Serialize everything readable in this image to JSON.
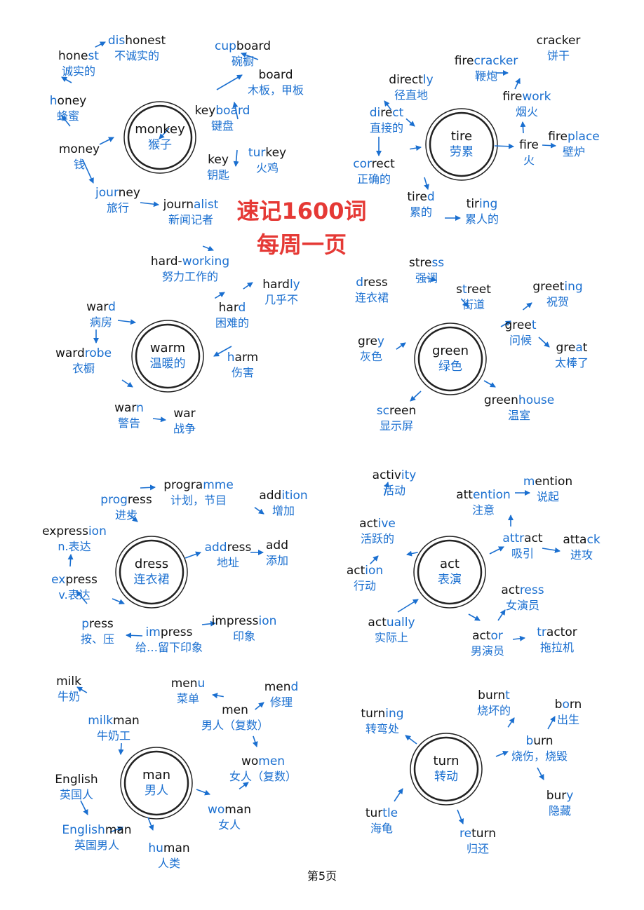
{
  "title_lines": [
    "速记1600词",
    "每周一页"
  ],
  "footer": "第5页",
  "colors": {
    "accent": "#1a6fd0",
    "title": "#e53935",
    "text": "#111111"
  },
  "clusters": [
    {
      "hub": {
        "en": "monkey",
        "zh": "猴子"
      },
      "nodes": [
        {
          "id": "dishonest",
          "parts": [
            [
              "dis",
              "h"
            ],
            [
              "honest",
              "b"
            ]
          ],
          "zh": "不诚实的"
        },
        {
          "id": "honest",
          "parts": [
            [
              "hone",
              "b"
            ],
            [
              "st",
              "h"
            ]
          ],
          "zh": "诚实的"
        },
        {
          "id": "honey",
          "parts": [
            [
              "h",
              "h"
            ],
            [
              "oney",
              "b"
            ]
          ],
          "zh": "蜂蜜"
        },
        {
          "id": "money",
          "parts": [
            [
              "money",
              "b"
            ]
          ],
          "zh": "钱"
        },
        {
          "id": "journey",
          "parts": [
            [
              "jour",
              "h"
            ],
            [
              "ney",
              "b"
            ]
          ],
          "zh": "旅行"
        },
        {
          "id": "journalist",
          "parts": [
            [
              "journ",
              "b"
            ],
            [
              "alist",
              "h"
            ]
          ],
          "zh": "新闻记者"
        },
        {
          "id": "cupboard",
          "parts": [
            [
              "cup",
              "h"
            ],
            [
              "board",
              "b"
            ]
          ],
          "zh": "碗橱"
        },
        {
          "id": "board",
          "parts": [
            [
              "board",
              "b"
            ]
          ],
          "zh": "木板，甲板"
        },
        {
          "id": "keyboard",
          "parts": [
            [
              "key",
              "b"
            ],
            [
              "board",
              "h"
            ]
          ],
          "zh": "键盘"
        },
        {
          "id": "key",
          "parts": [
            [
              "key",
              "b"
            ]
          ],
          "zh": "钥匙"
        },
        {
          "id": "turkey",
          "parts": [
            [
              "tur",
              "h"
            ],
            [
              "key",
              "b"
            ]
          ],
          "zh": "火鸡"
        }
      ]
    },
    {
      "hub": {
        "en": "tire",
        "zh": "劳累"
      },
      "nodes": [
        {
          "id": "directly",
          "parts": [
            [
              "direct",
              "b"
            ],
            [
              "ly",
              "h"
            ]
          ],
          "zh": "径直地"
        },
        {
          "id": "direct",
          "parts": [
            [
              "di",
              "h"
            ],
            [
              "re",
              "b"
            ],
            [
              "ct",
              "h"
            ]
          ],
          "zh": "直接的"
        },
        {
          "id": "correct",
          "parts": [
            [
              "cor",
              "h"
            ],
            [
              "rect",
              "b"
            ]
          ],
          "zh": "正确的"
        },
        {
          "id": "tired",
          "parts": [
            [
              "tire",
              "b"
            ],
            [
              "d",
              "h"
            ]
          ],
          "zh": "累的"
        },
        {
          "id": "tiring",
          "parts": [
            [
              "tir",
              "b"
            ],
            [
              "ing",
              "h"
            ]
          ],
          "zh": "累人的"
        },
        {
          "id": "cracker",
          "parts": [
            [
              "cracker",
              "b"
            ]
          ],
          "zh": "饼干"
        },
        {
          "id": "firecracker",
          "parts": [
            [
              "fire",
              "b"
            ],
            [
              "cracker",
              "h"
            ]
          ],
          "zh": "鞭炮"
        },
        {
          "id": "firework",
          "parts": [
            [
              "fire",
              "b"
            ],
            [
              "work",
              "h"
            ]
          ],
          "zh": "烟火"
        },
        {
          "id": "fire",
          "parts": [
            [
              "fire",
              "b"
            ]
          ],
          "zh": "火"
        },
        {
          "id": "fireplace",
          "parts": [
            [
              "fire",
              "b"
            ],
            [
              "place",
              "h"
            ]
          ],
          "zh": "壁炉"
        }
      ]
    },
    {
      "hub": {
        "en": "warm",
        "zh": "温暖的"
      },
      "nodes": [
        {
          "id": "hard-working",
          "parts": [
            [
              "hard-",
              "b"
            ],
            [
              "working",
              "h"
            ]
          ],
          "zh": "努力工作的"
        },
        {
          "id": "hardly",
          "parts": [
            [
              "hard",
              "b"
            ],
            [
              "ly",
              "h"
            ]
          ],
          "zh": "几乎不"
        },
        {
          "id": "hard",
          "parts": [
            [
              "har",
              "b"
            ],
            [
              "d",
              "h"
            ]
          ],
          "zh": "困难的"
        },
        {
          "id": "harm",
          "parts": [
            [
              "h",
              "h"
            ],
            [
              "arm",
              "b"
            ]
          ],
          "zh": "伤害"
        },
        {
          "id": "ward",
          "parts": [
            [
              "war",
              "b"
            ],
            [
              "d",
              "h"
            ]
          ],
          "zh": "病房"
        },
        {
          "id": "wardrobe",
          "parts": [
            [
              "ward",
              "b"
            ],
            [
              "robe",
              "h"
            ]
          ],
          "zh": "衣橱"
        },
        {
          "id": "warn",
          "parts": [
            [
              "war",
              "b"
            ],
            [
              "n",
              "h"
            ]
          ],
          "zh": "警告"
        },
        {
          "id": "war",
          "parts": [
            [
              "war",
              "b"
            ]
          ],
          "zh": "战争"
        }
      ]
    },
    {
      "hub": {
        "en": "green",
        "zh": "绿色"
      },
      "nodes": [
        {
          "id": "stress",
          "parts": [
            [
              "stre",
              "b"
            ],
            [
              "ss",
              "h"
            ]
          ],
          "zh": "强调"
        },
        {
          "id": "dress",
          "parts": [
            [
              "d",
              "h"
            ],
            [
              "ress",
              "b"
            ]
          ],
          "zh": "连衣裙"
        },
        {
          "id": "street",
          "parts": [
            [
              "s",
              "b"
            ],
            [
              "t",
              "h"
            ],
            [
              "reet",
              "b"
            ]
          ],
          "zh": "街道"
        },
        {
          "id": "greeting",
          "parts": [
            [
              "greet",
              "b"
            ],
            [
              "ing",
              "h"
            ]
          ],
          "zh": "祝贺"
        },
        {
          "id": "greet",
          "parts": [
            [
              "gree",
              "b"
            ],
            [
              "t",
              "h"
            ]
          ],
          "zh": "问候"
        },
        {
          "id": "great",
          "parts": [
            [
              "gre",
              "b"
            ],
            [
              "a",
              "h"
            ],
            [
              "t",
              "b"
            ]
          ],
          "zh": "太棒了"
        },
        {
          "id": "grey",
          "parts": [
            [
              "gre",
              "b"
            ],
            [
              "y",
              "h"
            ]
          ],
          "zh": "灰色"
        },
        {
          "id": "screen",
          "parts": [
            [
              "sc",
              "h"
            ],
            [
              "reen",
              "b"
            ]
          ],
          "zh": "显示屏"
        },
        {
          "id": "greenhouse",
          "parts": [
            [
              "green",
              "b"
            ],
            [
              "house",
              "h"
            ]
          ],
          "zh": "温室"
        }
      ]
    },
    {
      "hub": {
        "en": "dress",
        "zh": "连衣裙"
      },
      "nodes": [
        {
          "id": "programme",
          "parts": [
            [
              "progra",
              "b"
            ],
            [
              "mme",
              "h"
            ]
          ],
          "zh": "计划，节目"
        },
        {
          "id": "progress",
          "parts": [
            [
              "prog",
              "h"
            ],
            [
              "ress",
              "b"
            ]
          ],
          "zh": "进步"
        },
        {
          "id": "addition",
          "parts": [
            [
              "add",
              "b"
            ],
            [
              "ition",
              "h"
            ]
          ],
          "zh": "增加"
        },
        {
          "id": "expression",
          "parts": [
            [
              "express",
              "b"
            ],
            [
              "ion",
              "h"
            ]
          ],
          "zh": "n.表达"
        },
        {
          "id": "address",
          "parts": [
            [
              "add",
              "h"
            ],
            [
              "ress",
              "b"
            ]
          ],
          "zh": "地址"
        },
        {
          "id": "add",
          "parts": [
            [
              "add",
              "b"
            ]
          ],
          "zh": "添加"
        },
        {
          "id": "express",
          "parts": [
            [
              "ex",
              "h"
            ],
            [
              "press",
              "b"
            ]
          ],
          "zh": "v.表达"
        },
        {
          "id": "press",
          "parts": [
            [
              "p",
              "h"
            ],
            [
              "ress",
              "b"
            ]
          ],
          "zh": "按、压"
        },
        {
          "id": "impress",
          "parts": [
            [
              "im",
              "h"
            ],
            [
              "press",
              "b"
            ]
          ],
          "zh": "给…留下印象"
        },
        {
          "id": "impression",
          "parts": [
            [
              "impress",
              "b"
            ],
            [
              "ion",
              "h"
            ]
          ],
          "zh": "印象"
        }
      ]
    },
    {
      "hub": {
        "en": "act",
        "zh": "表演"
      },
      "nodes": [
        {
          "id": "activity",
          "parts": [
            [
              "activ",
              "b"
            ],
            [
              "ity",
              "h"
            ]
          ],
          "zh": "活动"
        },
        {
          "id": "mention",
          "parts": [
            [
              "m",
              "h"
            ],
            [
              "ention",
              "b"
            ]
          ],
          "zh": "说起"
        },
        {
          "id": "attention",
          "parts": [
            [
              "att",
              "b"
            ],
            [
              "ention",
              "h"
            ]
          ],
          "zh": "注意"
        },
        {
          "id": "active",
          "parts": [
            [
              "act",
              "b"
            ],
            [
              "ive",
              "h"
            ]
          ],
          "zh": "活跃的"
        },
        {
          "id": "attract",
          "parts": [
            [
              "attr",
              "h"
            ],
            [
              "act",
              "b"
            ]
          ],
          "zh": "吸引"
        },
        {
          "id": "attack",
          "parts": [
            [
              "atta",
              "b"
            ],
            [
              "ck",
              "h"
            ]
          ],
          "zh": "进攻"
        },
        {
          "id": "action",
          "parts": [
            [
              "act",
              "b"
            ],
            [
              "ion",
              "h"
            ]
          ],
          "zh": "行动"
        },
        {
          "id": "actress",
          "parts": [
            [
              "act",
              "b"
            ],
            [
              "ress",
              "h"
            ]
          ],
          "zh": "女演员"
        },
        {
          "id": "actually",
          "parts": [
            [
              "act",
              "b"
            ],
            [
              "ually",
              "h"
            ]
          ],
          "zh": "实际上"
        },
        {
          "id": "actor",
          "parts": [
            [
              "act",
              "b"
            ],
            [
              "or",
              "h"
            ]
          ],
          "zh": "男演员"
        },
        {
          "id": "tractor",
          "parts": [
            [
              "tr",
              "h"
            ],
            [
              "actor",
              "b"
            ]
          ],
          "zh": "拖拉机"
        }
      ]
    },
    {
      "hub": {
        "en": "man",
        "zh": "男人"
      },
      "nodes": [
        {
          "id": "milk",
          "parts": [
            [
              "milk",
              "b"
            ]
          ],
          "zh": "牛奶"
        },
        {
          "id": "menu",
          "parts": [
            [
              "men",
              "b"
            ],
            [
              "u",
              "h"
            ]
          ],
          "zh": "菜单"
        },
        {
          "id": "mend",
          "parts": [
            [
              "men",
              "b"
            ],
            [
              "d",
              "h"
            ]
          ],
          "zh": "修理"
        },
        {
          "id": "milkman",
          "parts": [
            [
              "milk",
              "h"
            ],
            [
              "man",
              "b"
            ]
          ],
          "zh": "牛奶工"
        },
        {
          "id": "men",
          "parts": [
            [
              "men",
              "b"
            ]
          ],
          "zh": "男人（复数）"
        },
        {
          "id": "women",
          "parts": [
            [
              "wo",
              "b"
            ],
            [
              "men",
              "h"
            ]
          ],
          "zh": "女人（复数）"
        },
        {
          "id": "English",
          "parts": [
            [
              "English",
              "b"
            ]
          ],
          "zh": "英国人"
        },
        {
          "id": "woman",
          "parts": [
            [
              "wo",
              "h"
            ],
            [
              "man",
              "b"
            ]
          ],
          "zh": "女人"
        },
        {
          "id": "Englishman",
          "parts": [
            [
              "English",
              "h"
            ],
            [
              "man",
              "b"
            ]
          ],
          "zh": "英国男人"
        },
        {
          "id": "human",
          "parts": [
            [
              "hu",
              "h"
            ],
            [
              "man",
              "b"
            ]
          ],
          "zh": "人类"
        }
      ]
    },
    {
      "hub": {
        "en": "turn",
        "zh": "转动"
      },
      "nodes": [
        {
          "id": "burnt",
          "parts": [
            [
              "burn",
              "b"
            ],
            [
              "t",
              "h"
            ]
          ],
          "zh": "烧坏的"
        },
        {
          "id": "born",
          "parts": [
            [
              "b",
              "b"
            ],
            [
              "o",
              "h"
            ],
            [
              "rn",
              "b"
            ]
          ],
          "zh": "出生"
        },
        {
          "id": "turning",
          "parts": [
            [
              "turn",
              "b"
            ],
            [
              "ing",
              "h"
            ]
          ],
          "zh": "转弯处"
        },
        {
          "id": "burn",
          "parts": [
            [
              "b",
              "h"
            ],
            [
              "urn",
              "b"
            ]
          ],
          "zh": "烧伤，烧毁"
        },
        {
          "id": "bury",
          "parts": [
            [
              "bur",
              "b"
            ],
            [
              "y",
              "h"
            ]
          ],
          "zh": "隐藏"
        },
        {
          "id": "turtle",
          "parts": [
            [
              "tur",
              "b"
            ],
            [
              "tle",
              "h"
            ]
          ],
          "zh": "海龟"
        },
        {
          "id": "return",
          "parts": [
            [
              "re",
              "h"
            ],
            [
              "turn",
              "b"
            ]
          ],
          "zh": "归还"
        }
      ]
    }
  ]
}
